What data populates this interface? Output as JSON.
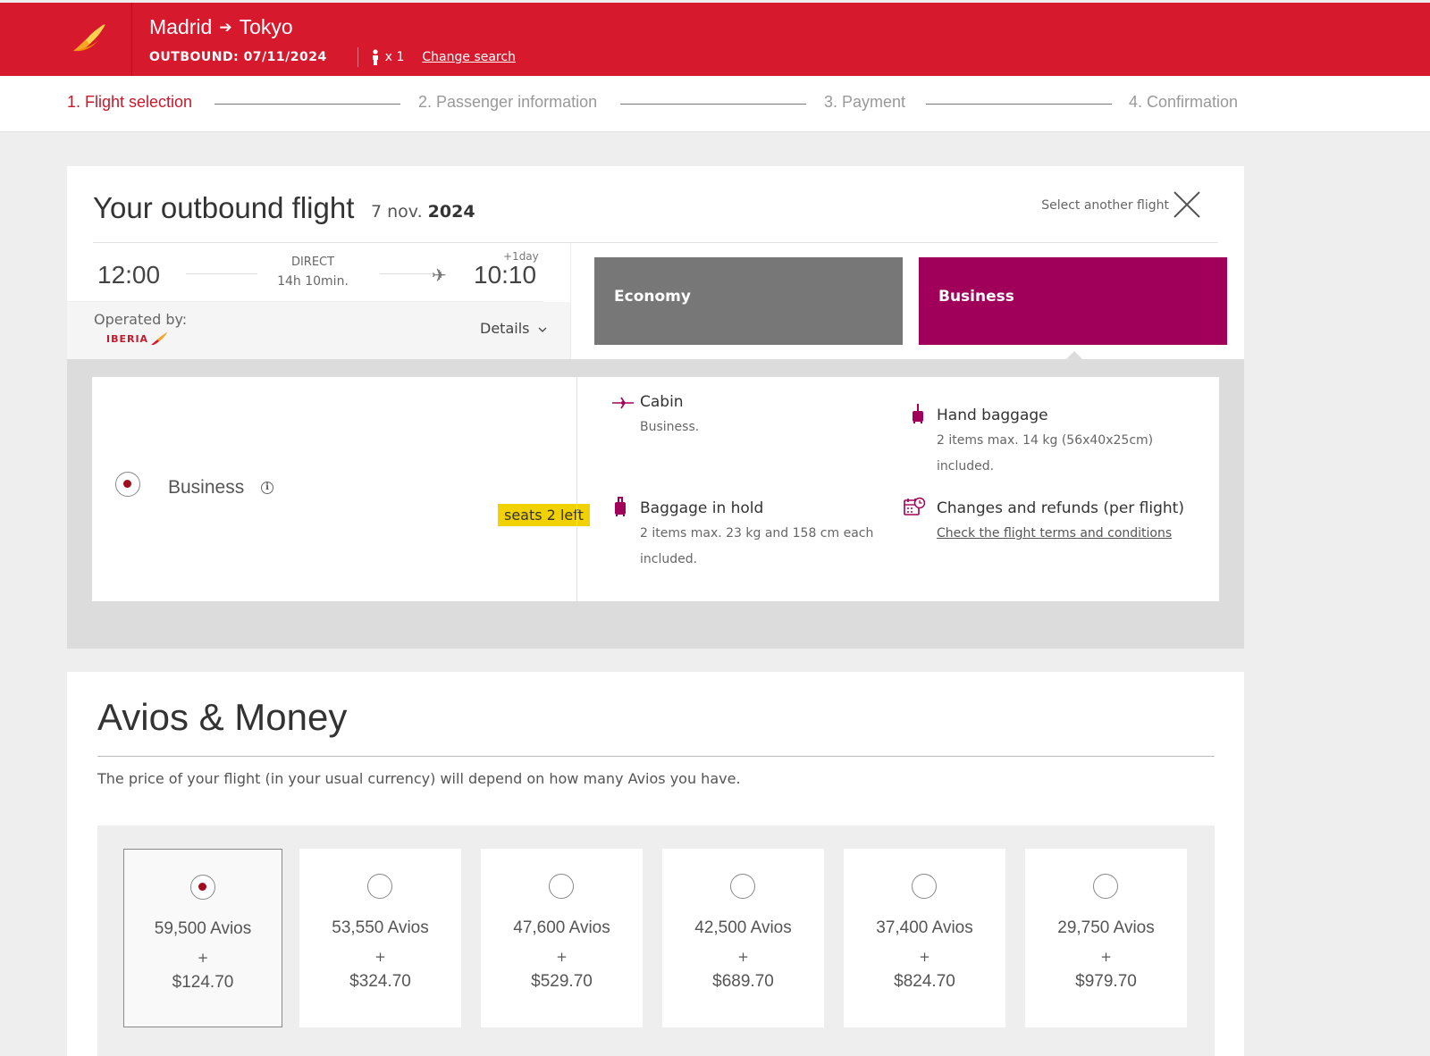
{
  "header": {
    "origin": "Madrid",
    "destination": "Tokyo",
    "outbound": "OUTBOUND: 07/11/2024",
    "passengers": "x 1",
    "change_search": "Change search"
  },
  "steps": [
    {
      "label": "1. Flight selection"
    },
    {
      "label": "2. Passenger information"
    },
    {
      "label": "3. Payment"
    },
    {
      "label": "4. Confirmation"
    }
  ],
  "flight": {
    "title": "Your outbound flight",
    "date_prefix": "7 nov.",
    "date_year": "2024",
    "select_another": "Select another flight",
    "departure": "12:00",
    "arrival": "10:10",
    "plus_day": "+1day",
    "direct": "DIRECT",
    "duration": "14h 10min.",
    "operated_by": "Operated by:",
    "carrier_logo": "IBERIA",
    "details": "Details"
  },
  "fare_tabs": {
    "economy": "Economy",
    "business": "Business"
  },
  "selected_fare": {
    "label": "Business",
    "seats_left": "seats 2 left",
    "features": {
      "cabin_title": "Cabin",
      "cabin_text": "Business.",
      "hand_title": "Hand baggage",
      "hand_text1": "2 items max. 14 kg (56x40x25cm)",
      "hand_text2": "included.",
      "hold_title": "Baggage in hold",
      "hold_text1": "2 items max. 23 kg and 158 cm each",
      "hold_text2": "included.",
      "changes_title": "Changes and refunds (per flight)",
      "changes_link": "Check the flight terms and conditions"
    }
  },
  "avios": {
    "title": "Avios & Money",
    "description": "The price of your flight (in your usual currency) will depend on how many Avios you have.",
    "plus": "+",
    "options": [
      {
        "avios": "59,500 Avios",
        "price": "$124.70",
        "selected": true
      },
      {
        "avios": "53,550 Avios",
        "price": "$324.70",
        "selected": false
      },
      {
        "avios": "47,600 Avios",
        "price": "$529.70",
        "selected": false
      },
      {
        "avios": "42,500 Avios",
        "price": "$689.70",
        "selected": false
      },
      {
        "avios": "37,400 Avios",
        "price": "$824.70",
        "selected": false
      },
      {
        "avios": "29,750 Avios",
        "price": "$979.70",
        "selected": false
      }
    ]
  },
  "colors": {
    "brand_red": "#d7192d",
    "business_purple": "#a0005a",
    "economy_grey": "#777777",
    "badge_yellow": "#f2d100"
  },
  "icons": [
    "iberia-logo-icon",
    "arrow-right-icon",
    "person-icon",
    "close-icon",
    "plane-icon",
    "chevron-down-icon",
    "info-icon",
    "cabin-plane-icon",
    "hand-baggage-icon",
    "hold-baggage-icon",
    "calendar-clock-icon"
  ]
}
